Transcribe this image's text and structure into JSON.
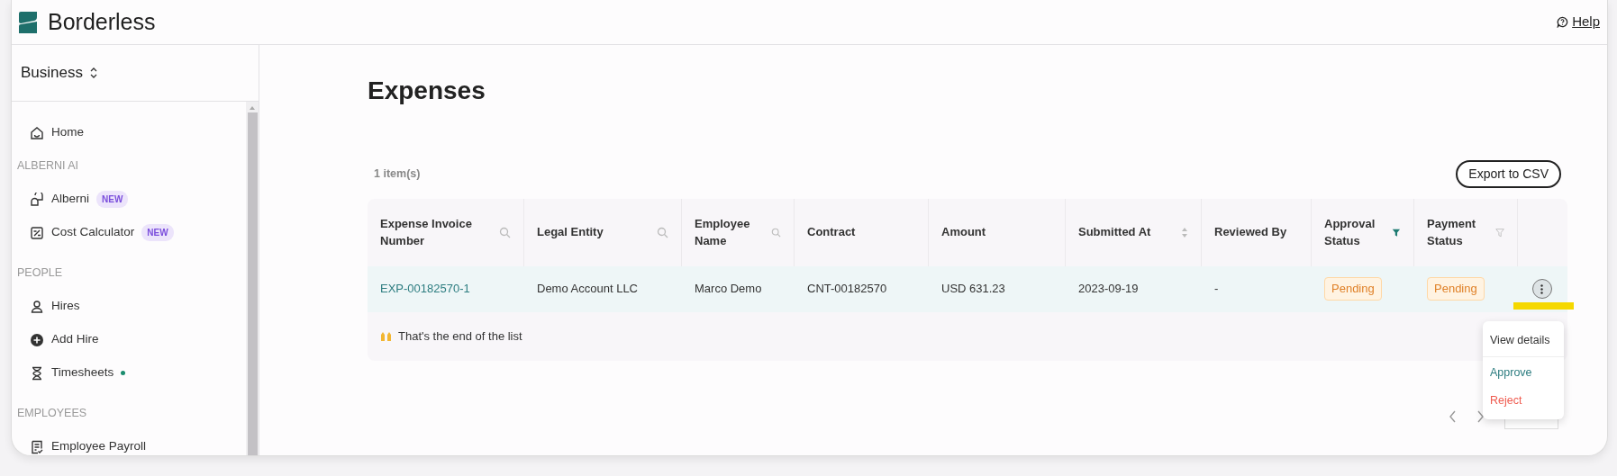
{
  "header": {
    "brand": "Borderless",
    "help": "Help"
  },
  "sidebar": {
    "workspace": "Business",
    "items": [
      {
        "kind": "item",
        "label": "Home"
      },
      {
        "kind": "section",
        "label": "ALBERNI AI"
      },
      {
        "kind": "item",
        "label": "Alberni",
        "badge": "NEW"
      },
      {
        "kind": "item",
        "label": "Cost Calculator",
        "badge": "NEW"
      },
      {
        "kind": "section",
        "label": "PEOPLE"
      },
      {
        "kind": "item",
        "label": "Hires"
      },
      {
        "kind": "item",
        "label": "Add Hire"
      },
      {
        "kind": "item",
        "label": "Timesheets",
        "dot": true
      },
      {
        "kind": "section",
        "label": "EMPLOYEES"
      },
      {
        "kind": "item",
        "label": "Employee Payroll"
      }
    ]
  },
  "page": {
    "title": "Expenses",
    "count": "1 item(s)",
    "export": "Export to CSV"
  },
  "table": {
    "columns": [
      {
        "label": "Expense Invoice Number",
        "kind": "search"
      },
      {
        "label": "Legal Entity",
        "kind": "search"
      },
      {
        "label": "Employee Name",
        "kind": "search"
      },
      {
        "label": "Contract",
        "kind": "plain"
      },
      {
        "label": "Amount",
        "kind": "plain"
      },
      {
        "label": "Submitted At",
        "kind": "sort"
      },
      {
        "label": "Reviewed By",
        "kind": "plain"
      },
      {
        "label": "Approval Status",
        "kind": "filter",
        "filtered": true
      },
      {
        "label": "Payment Status",
        "kind": "filter",
        "filtered": false
      }
    ],
    "rows": [
      {
        "highlighted": true,
        "menu_open": true,
        "cells": [
          "EXP-00182570-1",
          "Demo Account LLC",
          "Marco Demo",
          "CNT-00182570",
          "USD 631.23",
          "2023-09-19",
          "-",
          "Pending",
          "Pending"
        ]
      }
    ],
    "end_note": "That's the end of the list"
  },
  "row_menu": [
    {
      "label": "View details",
      "kind": "default"
    },
    {
      "label": "Approve",
      "kind": "positive"
    },
    {
      "label": "Reject",
      "kind": "danger"
    }
  ]
}
